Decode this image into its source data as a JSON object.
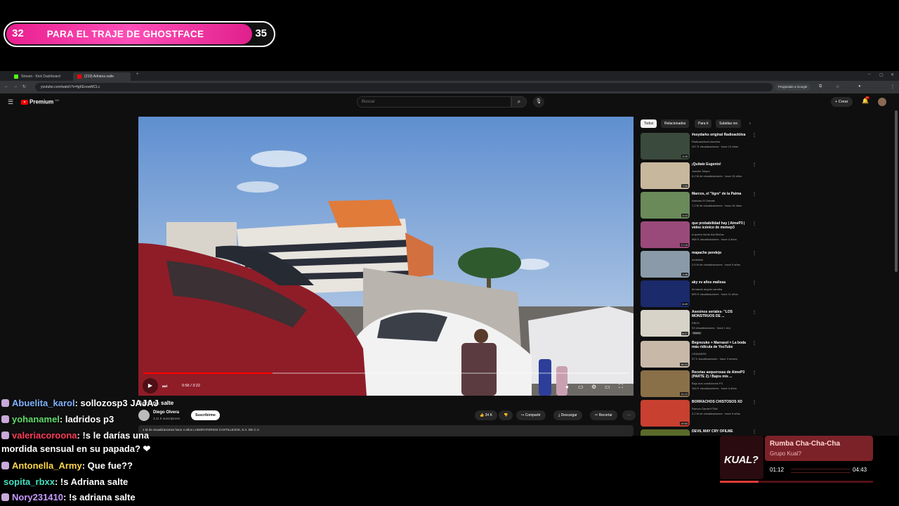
{
  "goal": {
    "current": "32",
    "label": "PARA EL TRAJE DE GHOSTFACE",
    "target": "35"
  },
  "browser": {
    "tabs": [
      {
        "label": "Stream - Kick Dashboard"
      },
      {
        "label": "(219) Adriana salte"
      }
    ],
    "url": "youtube.com/watch?v=fgKEoowMCLc",
    "google_btn": "Pregúntale a Google"
  },
  "youtube": {
    "logo": "Premium",
    "logo_sup": "MX",
    "search_placeholder": "Buscar",
    "create": "Crear",
    "notif_count": "9+",
    "player": {
      "time": "0:56 / 3:22",
      "progress": 0.267
    },
    "title": "Adriana salte",
    "channel": "Diego Olvera",
    "subs": "3,11 K suscriptores",
    "subscribe": "Suscribirme",
    "likes": "34 K",
    "share": "Compartir",
    "download": "Descargar",
    "clip": "Recortar",
    "desc": "1 M de visualizaciones  hace 4 años  LABORATORIOS CASTILLEJOS, S.A. DE C.V.",
    "chips": [
      "Todos",
      "Relacionados",
      "Para ti",
      "Subidas rec"
    ],
    "recommended": [
      {
        "title": "#soydarks original Radioacktiva",
        "channel": "RadioacktivaColombia",
        "meta": "427 K visualizaciones · hace 13 años",
        "duration": "3:25"
      },
      {
        "title": "¡Quítate Eugenio!",
        "channel": "Juanito Tolopo",
        "meta": "6,2 M de visualizaciones · hace 15 años",
        "duration": "7:00"
      },
      {
        "title": "Marcos, el \"tigre\" de la Palma",
        "channel": "Noticias El Debate",
        "meta": "7,2 M de visualizaciones · hace 16 años",
        "duration": "3:10"
      },
      {
        "title": "que probabilidad hay | AimeP3 | video icónico de memep3",
        "channel": "si quiero lloriar Ala Muñoz",
        "meta": "968 K visualizaciones · hace 4 años",
        "duration": "17:15"
      },
      {
        "title": "mapache pendejo",
        "channel": "aXdiokkk",
        "meta": "2,5 M de visualizaciones · hace 9 años",
        "duration": "1:08"
      },
      {
        "title": "aky xv años malissa",
        "channel": "fernando angulo saraiba",
        "meta": "899 K visualizaciones · hace 11 años",
        "duration": "8:49"
      },
      {
        "title": "Asesinos seriales- \"LOS MONSTRUOS DE ...",
        "channel": "FBI19",
        "meta": "93 visualizaciones · hace 1 día",
        "duration": "8:17",
        "badge": "Nuevo"
      },
      {
        "title": "Begrezuko + Marrasol = La boda más ridícula de YouTube",
        "channel": "CRINGEPE",
        "meta": "37 K visualizaciones · hace 3 meses",
        "duration": "16:10"
      },
      {
        "title": "Recetas asquerosas de AimeP3 (PARTE 2) / Bajos mis ...",
        "channel": "Bajo dos condiciones P3",
        "meta": "154 K visualizaciones · hace 4 años",
        "duration": "11:12"
      },
      {
        "title": "BORRACHOS CHISTOSOS XD",
        "channel": "Ramon GamerYTMx",
        "meta": "3,2 M de visualizaciones · hace 9 años",
        "duration": "10:53"
      },
      {
        "title": "DEVIL MAY CRY OFILME",
        "channel": "",
        "meta": "",
        "duration": ""
      }
    ]
  },
  "chat": [
    {
      "user": "Abuelita_karol",
      "color": "#7fb3ff",
      "msg": ": sollozosp3 JAJAJ"
    },
    {
      "user": "yohanamel",
      "color": "#5edc6a",
      "msg": ": ladridos p3"
    },
    {
      "user": "valeriacoroona",
      "color": "#ff3d5a",
      "msg": ": !s le darías una"
    },
    {
      "user": "",
      "color": "#ffffff",
      "msg": "mordida sensual en su papada? ❤"
    },
    {
      "user": "Antonella_Army",
      "color": "#ffd54a",
      "msg": ": Que fue??"
    },
    {
      "user": "sopita_rbxx",
      "color": "#44e0c0",
      "msg": ": !s Adriana salte"
    },
    {
      "user": "Nory231410",
      "color": "#c79bff",
      "msg": ": !s adriana salte"
    }
  ],
  "music": {
    "title": "Rumba Cha-Cha-Cha",
    "artist": "Grupo Kual?",
    "elapsed": "01:12",
    "total": "04:43",
    "cover_text": "KUAL?",
    "progress": 0.25
  }
}
